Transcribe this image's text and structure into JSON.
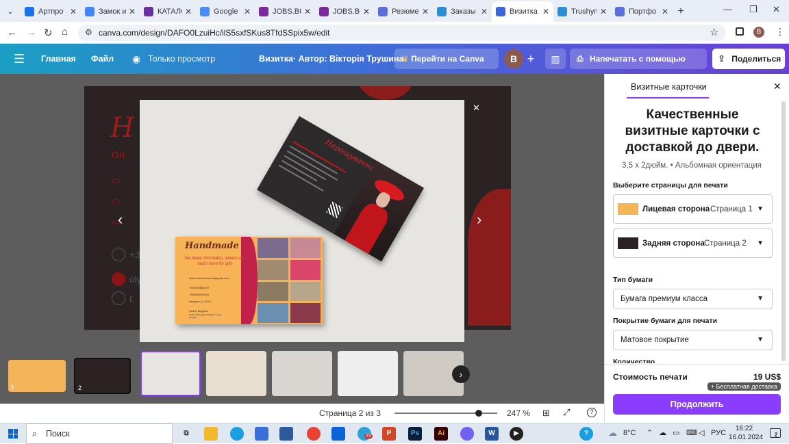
{
  "browser": {
    "tabs": [
      {
        "title": "Артпро",
        "color": "#1a73e8"
      },
      {
        "title": "Замок и",
        "color": "#4285f4"
      },
      {
        "title": "КАТАЛС",
        "color": "#6b2fa0"
      },
      {
        "title": "Google",
        "color": "#4c8bf5"
      },
      {
        "title": "JOBS.BG",
        "color": "#7b2b9c"
      },
      {
        "title": "JOBS.BG",
        "color": "#7b2b9c"
      },
      {
        "title": "Резюме",
        "color": "#5b6fd8"
      },
      {
        "title": "Заказы",
        "color": "#2c8fd6"
      },
      {
        "title": "Визитка",
        "color": "#3d66d8"
      },
      {
        "title": "Trushyn",
        "color": "#2b8fd6"
      },
      {
        "title": "Портфо",
        "color": "#5b6fd8"
      }
    ],
    "url": "canva.com/design/DAFO0LzuiHc/ilS5sxfSKus8TfdSSpix5w/edit",
    "profile_initial": "В"
  },
  "canva_header": {
    "home": "Главная",
    "file": "Файл",
    "view_only": "Только просмотр",
    "doc_title": "Визитка",
    "author_label": "· Автор:",
    "author": "Вікторія Трушина",
    "pro_button": "Перейти на Canva Pro",
    "avatar": "В",
    "print_button": "Напечатать с помощью Canva",
    "share_button": "Поделиться"
  },
  "design_preview": {
    "card_back_title": "Нарощування волос",
    "card_front_title": "Handmade",
    "card_front_sub": "We make chocolates, sweets and much more for gifts",
    "card_front_email": "look.in.all.endeavors@gmail.com",
    "card_front_phone1": "+359876655376",
    "card_front_phone2": "+359888234904",
    "card_front_ig": "designer_in_2023",
    "card_front_city": "Varna, Bulgaria",
    "card_front_delivery": "Delivery throughout Bulgaria is also possible.",
    "bg_texts": [
      "Н",
      "Ол",
      "+3",
      "oly",
      "г."
    ]
  },
  "status": {
    "page": "Страница 2 из 3",
    "zoom": "247 %",
    "zoom_level": 0.82
  },
  "panel": {
    "tab": "Визитные карточки",
    "heading": "Качественные визитные карточки с доставкой до двери.",
    "subtitle": "3,5 x 2дюйм. • Альбомная ориентация",
    "pages_label": "Выберите страницы для печати",
    "front_label": "Лицевая сторона",
    "front_page": "Страница 1",
    "back_label": "Задняя сторона",
    "back_page": "Страница 2",
    "paper_label": "Тип бумаги",
    "paper_value": "Бумага премиум класса",
    "coating_label": "Покрытие бумаги для печати",
    "coating_value": "Матовое покрытие",
    "qty_label": "Количество",
    "price_label": "Стоимость печати",
    "price_value": "19 US$",
    "delivery_badge": "+ Бесплатная доставка",
    "continue": "Продолжить"
  },
  "taskbar": {
    "search": "Поиск",
    "weather": "8°C",
    "lang": "РУС",
    "time": "16:22",
    "date": "16.01.2024",
    "notif": "2",
    "badge_whatsapp": "23"
  },
  "colors": {
    "accent": "#8b3dff",
    "header_start": "#1a9fc3",
    "header_end": "#6a3fd6",
    "red": "#c0161b"
  }
}
